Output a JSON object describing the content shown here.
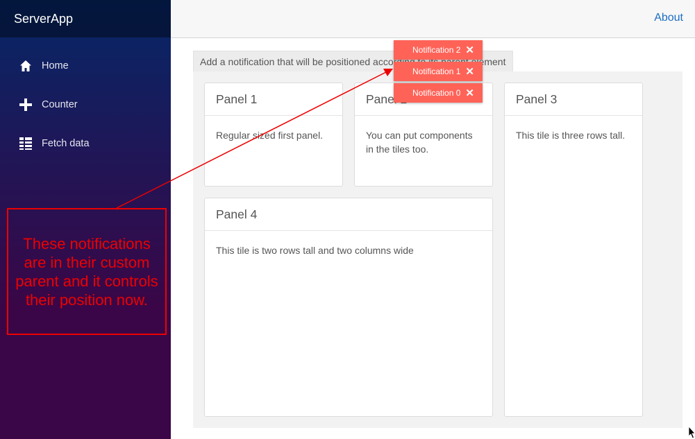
{
  "sidebar": {
    "brand": "ServerApp",
    "items": [
      {
        "label": "Home",
        "icon": "home-icon"
      },
      {
        "label": "Counter",
        "icon": "plus-icon"
      },
      {
        "label": "Fetch data",
        "icon": "list-icon"
      }
    ]
  },
  "topbar": {
    "about_label": "About"
  },
  "main": {
    "hint": "Add a notification that will be positioned according to its parent element",
    "panels": [
      {
        "title": "Panel 1",
        "body": "Regular sized first panel."
      },
      {
        "title": "Panel 2",
        "body": "You can put components in the tiles too."
      },
      {
        "title": "Panel 3",
        "body": "This tile is three rows tall."
      },
      {
        "title": "Panel 4",
        "body": "This tile is two rows tall and two columns wide"
      }
    ]
  },
  "notifications": [
    {
      "label": "Notification 2"
    },
    {
      "label": "Notification 1"
    },
    {
      "label": "Notification 0"
    }
  ],
  "callout": {
    "text": "These notifications are in their custom parent and it controls their position now."
  },
  "colors": {
    "notification": "#ff6358",
    "callout": "#ee0000",
    "link": "#1b6ec2"
  }
}
